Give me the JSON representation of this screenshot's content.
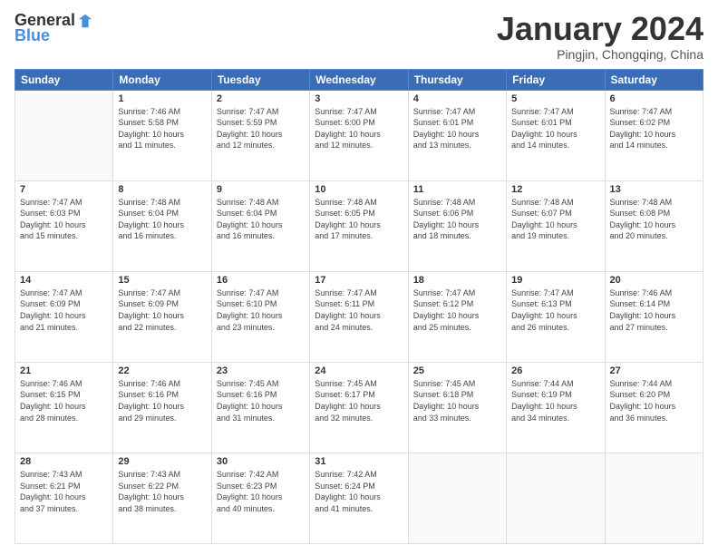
{
  "logo": {
    "general": "General",
    "blue": "Blue"
  },
  "header": {
    "title": "January 2024",
    "subtitle": "Pingjin, Chongqing, China"
  },
  "weekdays": [
    "Sunday",
    "Monday",
    "Tuesday",
    "Wednesday",
    "Thursday",
    "Friday",
    "Saturday"
  ],
  "weeks": [
    [
      {
        "day": "",
        "sunrise": "",
        "sunset": "",
        "daylight": ""
      },
      {
        "day": "1",
        "sunrise": "7:46 AM",
        "sunset": "5:58 PM",
        "daylight": "10 hours and 11 minutes."
      },
      {
        "day": "2",
        "sunrise": "7:47 AM",
        "sunset": "5:59 PM",
        "daylight": "10 hours and 12 minutes."
      },
      {
        "day": "3",
        "sunrise": "7:47 AM",
        "sunset": "6:00 PM",
        "daylight": "10 hours and 12 minutes."
      },
      {
        "day": "4",
        "sunrise": "7:47 AM",
        "sunset": "6:01 PM",
        "daylight": "10 hours and 13 minutes."
      },
      {
        "day": "5",
        "sunrise": "7:47 AM",
        "sunset": "6:01 PM",
        "daylight": "10 hours and 14 minutes."
      },
      {
        "day": "6",
        "sunrise": "7:47 AM",
        "sunset": "6:02 PM",
        "daylight": "10 hours and 14 minutes."
      }
    ],
    [
      {
        "day": "7",
        "sunrise": "7:47 AM",
        "sunset": "6:03 PM",
        "daylight": "10 hours and 15 minutes."
      },
      {
        "day": "8",
        "sunrise": "7:48 AM",
        "sunset": "6:04 PM",
        "daylight": "10 hours and 16 minutes."
      },
      {
        "day": "9",
        "sunrise": "7:48 AM",
        "sunset": "6:04 PM",
        "daylight": "10 hours and 16 minutes."
      },
      {
        "day": "10",
        "sunrise": "7:48 AM",
        "sunset": "6:05 PM",
        "daylight": "10 hours and 17 minutes."
      },
      {
        "day": "11",
        "sunrise": "7:48 AM",
        "sunset": "6:06 PM",
        "daylight": "10 hours and 18 minutes."
      },
      {
        "day": "12",
        "sunrise": "7:48 AM",
        "sunset": "6:07 PM",
        "daylight": "10 hours and 19 minutes."
      },
      {
        "day": "13",
        "sunrise": "7:48 AM",
        "sunset": "6:08 PM",
        "daylight": "10 hours and 20 minutes."
      }
    ],
    [
      {
        "day": "14",
        "sunrise": "7:47 AM",
        "sunset": "6:09 PM",
        "daylight": "10 hours and 21 minutes."
      },
      {
        "day": "15",
        "sunrise": "7:47 AM",
        "sunset": "6:09 PM",
        "daylight": "10 hours and 22 minutes."
      },
      {
        "day": "16",
        "sunrise": "7:47 AM",
        "sunset": "6:10 PM",
        "daylight": "10 hours and 23 minutes."
      },
      {
        "day": "17",
        "sunrise": "7:47 AM",
        "sunset": "6:11 PM",
        "daylight": "10 hours and 24 minutes."
      },
      {
        "day": "18",
        "sunrise": "7:47 AM",
        "sunset": "6:12 PM",
        "daylight": "10 hours and 25 minutes."
      },
      {
        "day": "19",
        "sunrise": "7:47 AM",
        "sunset": "6:13 PM",
        "daylight": "10 hours and 26 minutes."
      },
      {
        "day": "20",
        "sunrise": "7:46 AM",
        "sunset": "6:14 PM",
        "daylight": "10 hours and 27 minutes."
      }
    ],
    [
      {
        "day": "21",
        "sunrise": "7:46 AM",
        "sunset": "6:15 PM",
        "daylight": "10 hours and 28 minutes."
      },
      {
        "day": "22",
        "sunrise": "7:46 AM",
        "sunset": "6:16 PM",
        "daylight": "10 hours and 29 minutes."
      },
      {
        "day": "23",
        "sunrise": "7:45 AM",
        "sunset": "6:16 PM",
        "daylight": "10 hours and 31 minutes."
      },
      {
        "day": "24",
        "sunrise": "7:45 AM",
        "sunset": "6:17 PM",
        "daylight": "10 hours and 32 minutes."
      },
      {
        "day": "25",
        "sunrise": "7:45 AM",
        "sunset": "6:18 PM",
        "daylight": "10 hours and 33 minutes."
      },
      {
        "day": "26",
        "sunrise": "7:44 AM",
        "sunset": "6:19 PM",
        "daylight": "10 hours and 34 minutes."
      },
      {
        "day": "27",
        "sunrise": "7:44 AM",
        "sunset": "6:20 PM",
        "daylight": "10 hours and 36 minutes."
      }
    ],
    [
      {
        "day": "28",
        "sunrise": "7:43 AM",
        "sunset": "6:21 PM",
        "daylight": "10 hours and 37 minutes."
      },
      {
        "day": "29",
        "sunrise": "7:43 AM",
        "sunset": "6:22 PM",
        "daylight": "10 hours and 38 minutes."
      },
      {
        "day": "30",
        "sunrise": "7:42 AM",
        "sunset": "6:23 PM",
        "daylight": "10 hours and 40 minutes."
      },
      {
        "day": "31",
        "sunrise": "7:42 AM",
        "sunset": "6:24 PM",
        "daylight": "10 hours and 41 minutes."
      },
      {
        "day": "",
        "sunrise": "",
        "sunset": "",
        "daylight": ""
      },
      {
        "day": "",
        "sunrise": "",
        "sunset": "",
        "daylight": ""
      },
      {
        "day": "",
        "sunrise": "",
        "sunset": "",
        "daylight": ""
      }
    ]
  ],
  "labels": {
    "sunrise_prefix": "Sunrise: ",
    "sunset_prefix": "Sunset: ",
    "daylight_prefix": "Daylight: "
  }
}
